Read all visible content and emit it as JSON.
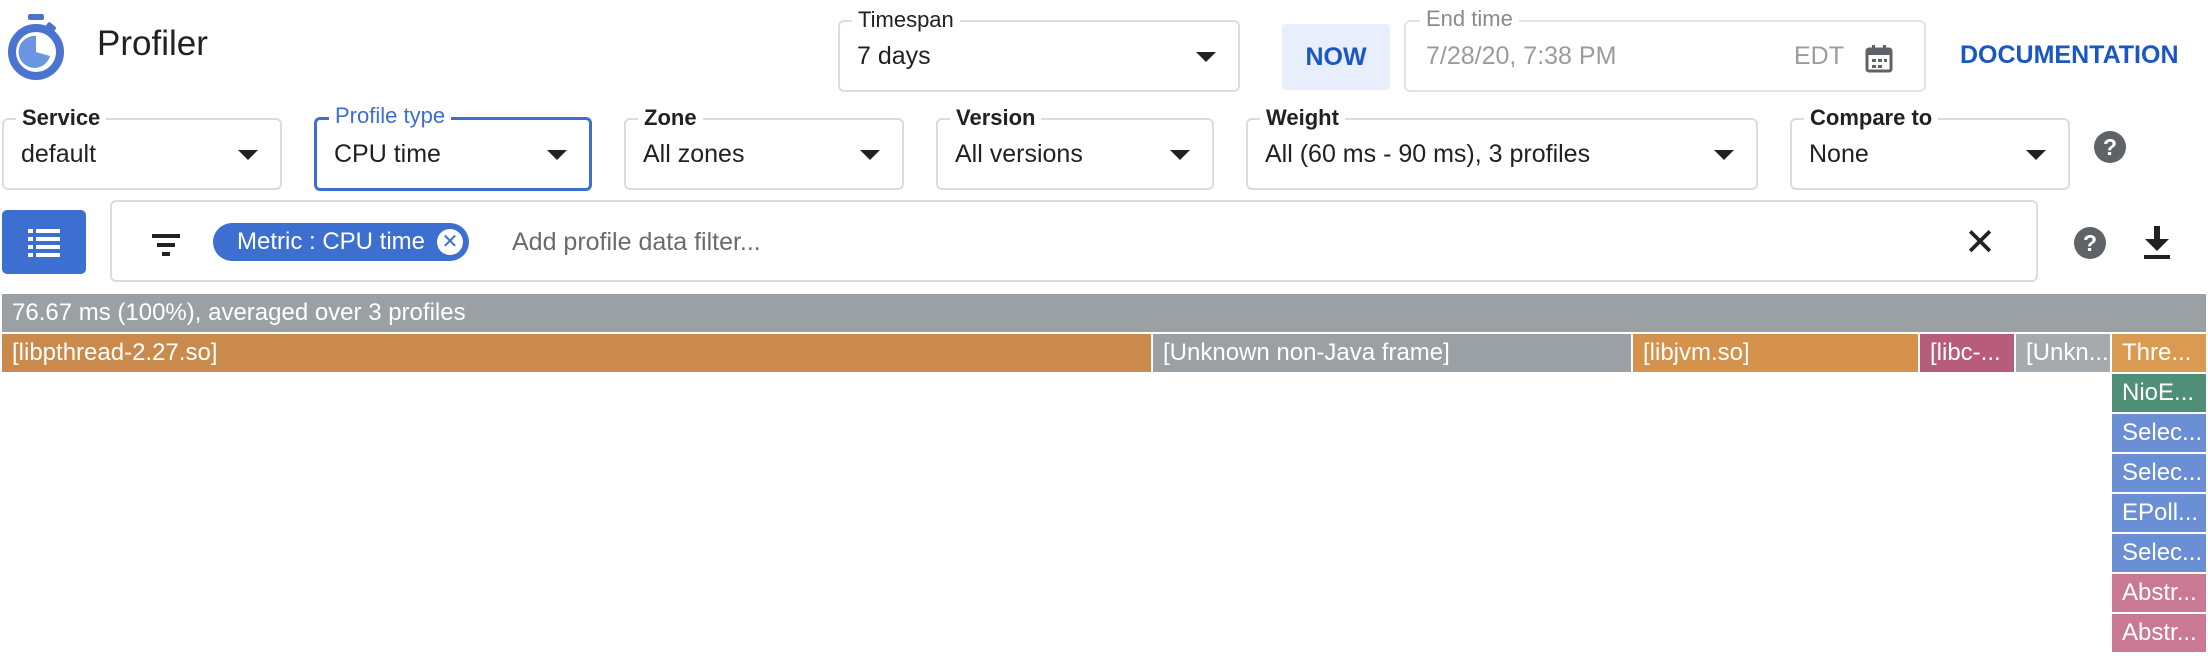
{
  "header": {
    "title": "Profiler",
    "timespan": {
      "label": "Timespan",
      "value": "7 days"
    },
    "now_label": "NOW",
    "end_time": {
      "label": "End time",
      "value": "7/28/20, 7:38 PM",
      "tz": "EDT"
    },
    "documentation_label": "DOCUMENTATION"
  },
  "filters": {
    "service": {
      "label": "Service",
      "value": "default"
    },
    "profile_type": {
      "label": "Profile type",
      "value": "CPU time"
    },
    "zone": {
      "label": "Zone",
      "value": "All zones"
    },
    "version": {
      "label": "Version",
      "value": "All versions"
    },
    "weight": {
      "label": "Weight",
      "value": "All (60 ms - 90 ms), 3 profiles"
    },
    "compare_to": {
      "label": "Compare to",
      "value": "None"
    },
    "help_glyph": "?"
  },
  "filter_bar": {
    "chip_label": "Metric : CPU time",
    "chip_close": "✕",
    "placeholder": "Add profile data filter...",
    "clear_glyph": "✕",
    "help_glyph": "?"
  },
  "flame": {
    "root_label": "76.67 ms (100%), averaged over 3 profiles",
    "row1": [
      {
        "label": "[libpthread-2.27.so]",
        "color": "#c98a4b"
      },
      {
        "label": "[Unknown non-Java frame]",
        "color": "#9aa0a3"
      },
      {
        "label": "[libjvm.so]",
        "color": "#d4924c"
      },
      {
        "label": "[libc-...",
        "color": "#b85c7c"
      },
      {
        "label": "[Unkn...",
        "color": "#a4aaad"
      },
      {
        "label": "Thre...",
        "color": "#d99a52"
      }
    ],
    "stack": [
      {
        "label": "NioE...",
        "color": "#4f8f77"
      },
      {
        "label": "Selec...",
        "color": "#6b8fd4"
      },
      {
        "label": "Selec...",
        "color": "#6b8fd4"
      },
      {
        "label": "EPoll...",
        "color": "#6b8fd4"
      },
      {
        "label": "Selec...",
        "color": "#6b8fd4"
      },
      {
        "label": "Abstr...",
        "color": "#c97a92"
      },
      {
        "label": "Abstr...",
        "color": "#c97a92"
      }
    ]
  }
}
